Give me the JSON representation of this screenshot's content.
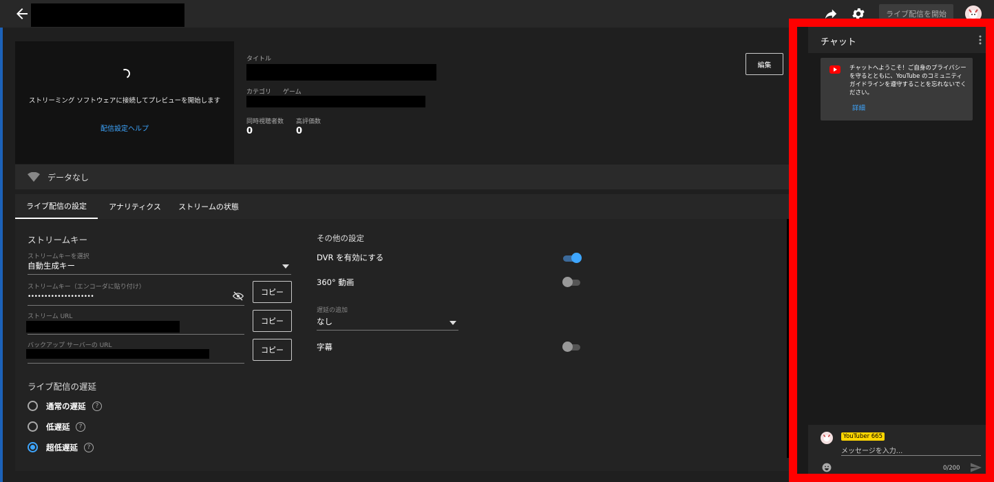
{
  "topbar": {
    "start_label": "ライブ配信を開始"
  },
  "preview": {
    "message": "ストリーミング ソフトウェアに接続してプレビューを開始します",
    "help_link": "配信設定ヘルプ"
  },
  "info": {
    "title_label": "タイトル",
    "category_label": "カテゴリ",
    "game_label": "ゲーム",
    "concurrent_label": "同時視聴者数",
    "concurrent_value": "0",
    "likes_label": "高評価数",
    "likes_value": "0",
    "edit_label": "編集"
  },
  "databar": {
    "text": "データなし"
  },
  "tabs": [
    {
      "label": "ライブ配信の設定",
      "active": true
    },
    {
      "label": "アナリティクス",
      "active": false
    },
    {
      "label": "ストリームの状態",
      "active": false
    }
  ],
  "stream_key": {
    "section_title": "ストリームキー",
    "select_label": "ストリームキーを選択",
    "select_value": "自動生成キー",
    "key_label": "ストリームキー（エンコーダに貼り付け）",
    "key_value": "••••••••••••••••••••",
    "url_label": "ストリーム URL",
    "backup_label": "バックアップ サーバーの URL",
    "copy_label": "コピー"
  },
  "latency": {
    "section_title": "ライブ配信の遅延",
    "options": [
      {
        "label": "通常の遅延",
        "selected": false
      },
      {
        "label": "低遅延",
        "selected": false
      },
      {
        "label": "超低遅延",
        "selected": true
      }
    ],
    "help": "?"
  },
  "other": {
    "section_title": "その他の設定",
    "dvr_label": "DVR を有効にする",
    "dvr_on": true,
    "video360_label": "360° 動画",
    "video360_on": false,
    "delay_label": "遅延の追加",
    "delay_value": "なし",
    "captions_label": "字幕",
    "captions_on": false
  },
  "chat": {
    "title": "チャット",
    "welcome": "チャットへようこそ！ご自身のプライバシーを守るとともに、YouTube のコミュニティ ガイドラインを遵守することを忘れないでください。",
    "welcome_link": "詳細",
    "username": "YouTuber 665",
    "placeholder": "メッセージを入力...",
    "counter": "0/200"
  },
  "colors": {
    "accent": "#3ea6ff",
    "highlight_border": "#ff0000",
    "badge": "#ffd600"
  }
}
